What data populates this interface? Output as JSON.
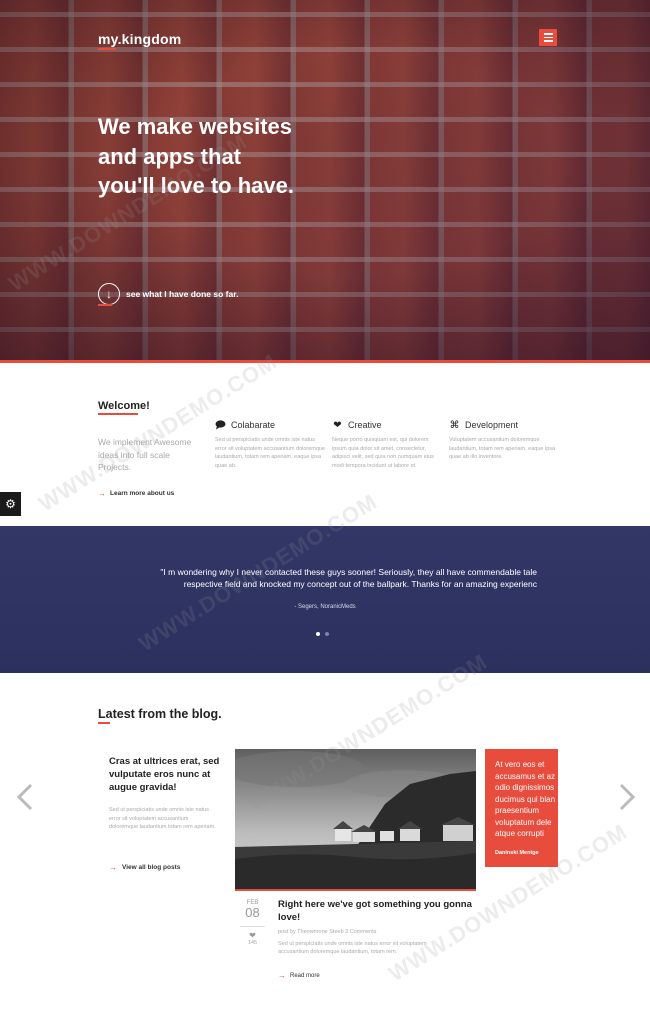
{
  "brand": {
    "logo": "my.kingdom",
    "accent": "#e84c3d",
    "dark_blue": "#2e3363"
  },
  "hero": {
    "title": "We make websites and apps that you'll love to have.",
    "cta": "see what I have done so far.",
    "menu_icon": "hamburger-icon",
    "cta_icon": "arrow-down-circle-icon"
  },
  "welcome": {
    "title": "Welcome!",
    "description": "We implement Awesome ideas into full scale Projects.",
    "learn_more": "Learn more about us",
    "features": [
      {
        "icon": "speech-bubble-icon",
        "title": "Colabarate",
        "text": "Sed ut perspiciatis unde omnis iste natus error sit voluptatem accusantium doloremque laudantium, totam rem aperiam, eaque ipsa quae ab."
      },
      {
        "icon": "heart-icon",
        "title": "Creative",
        "text": "Neque porro quisquam est, qui dolorem ipsum quia dolor sit amet, consectetur, adipisci velit, sed quia non numquam eius modi tempora incidunt ut labore et."
      },
      {
        "icon": "command-icon",
        "title": "Development",
        "text": "Voluptatem accusantium doloremque laudantium, totam rem aperiam, eaque ipsa quae ab illo inventore."
      }
    ]
  },
  "settings_icon": "gear-icon",
  "testimonial": {
    "line1": "\"I m wondering why I never contacted these guys sooner! Seriously, they all have commendable tale",
    "line2": "respective field and knocked my concept out of the ballpark. Thanks for an amazing experienc",
    "author": "- Segers, NoranicMeds",
    "slides": 2,
    "active_slide": 1
  },
  "blog": {
    "title": "Latest from the blog.",
    "left_post": {
      "title": "Cras at ultrices erat, sed vulputate eros nunc at augue gravida!",
      "text": "Sed ut perspiciatis unde omnis iste natus error sit voluptatem accusantium doloremque laudantium totam rem aperiam.",
      "view_all": "View all blog posts"
    },
    "main_post": {
      "month": "FEB",
      "day": "08",
      "likes": "145",
      "title": "Right here we've got something you gonna love!",
      "meta": "post by  Theownrone  Steeb  3 Comments",
      "text": "Sed ut perspiciatis unde omnis iste natus error sit voluptatem accusantium doloremque laudantium, totam rem.",
      "read_more": "Read more"
    },
    "quote_card": {
      "lines": [
        "At vero eos et",
        "accusamus et az",
        "odio dignissimos",
        "ducimus qui blan",
        "praesentium",
        "voluptatum dele",
        "atque corrupti"
      ],
      "author": "Daninski Mentge"
    },
    "prev_icon": "chevron-left-icon",
    "next_icon": "chevron-right-icon"
  },
  "watermark": "WWW.DOWNDEMO.COM"
}
